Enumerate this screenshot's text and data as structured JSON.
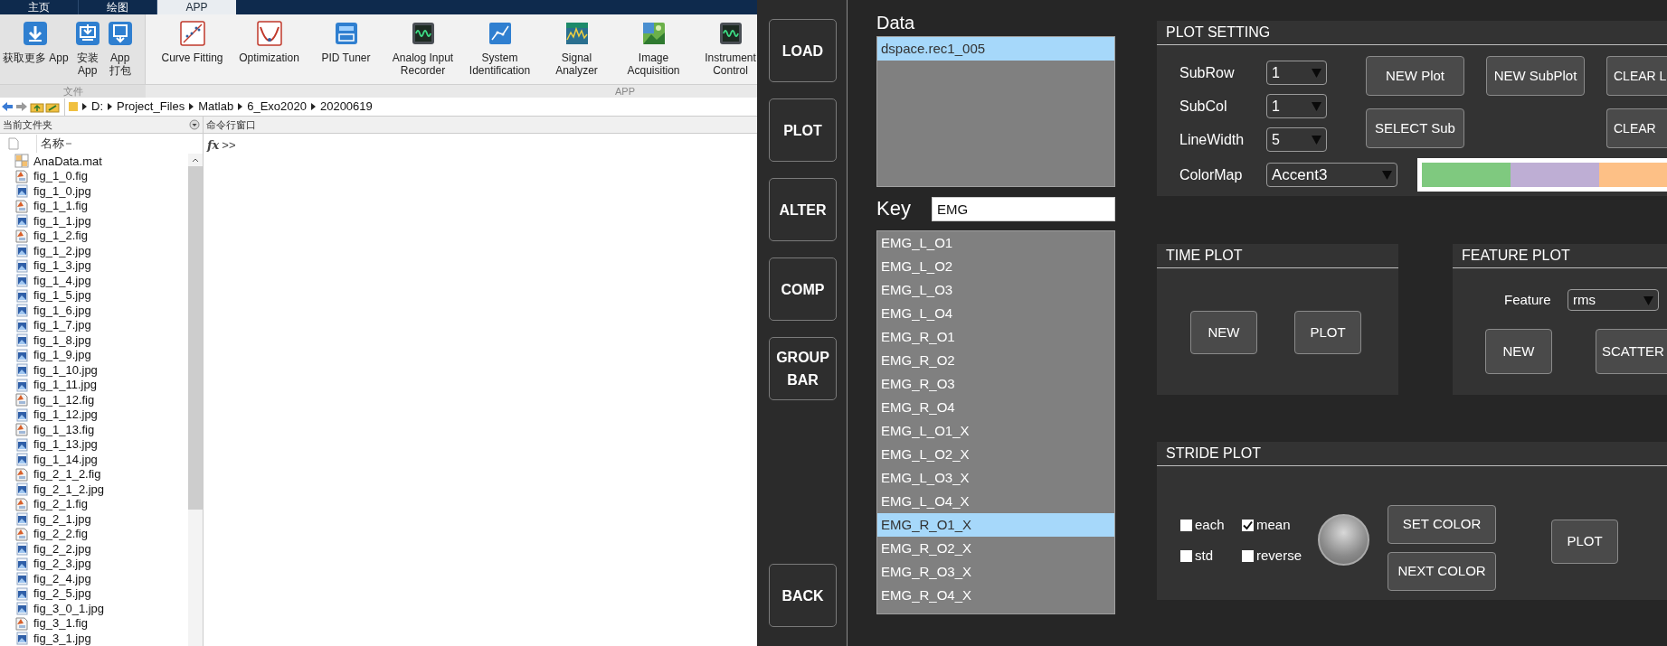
{
  "matlab": {
    "tabs": [
      {
        "label": "主页",
        "selected": false
      },
      {
        "label": "绘图",
        "selected": false
      },
      {
        "label": "APP",
        "selected": true
      }
    ],
    "toolstrip": [
      {
        "label": "文件",
        "tools": [
          {
            "kind": "download",
            "lines": [
              "获取更多 App"
            ]
          },
          {
            "kind": "install",
            "lines": [
              "安装",
              "App"
            ]
          },
          {
            "kind": "package",
            "lines": [
              "App",
              "打包"
            ]
          }
        ]
      },
      {
        "label": "APP",
        "tools": [
          {
            "kind": "curve",
            "lines": [
              "Curve Fitting"
            ]
          },
          {
            "kind": "optimization",
            "lines": [
              "Optimization"
            ]
          },
          {
            "kind": "pid",
            "lines": [
              "PID Tuner"
            ]
          },
          {
            "kind": "recorder",
            "lines": [
              "Analog Input",
              "Recorder"
            ]
          },
          {
            "kind": "identification",
            "lines": [
              "System",
              "Identification"
            ]
          },
          {
            "kind": "signal",
            "lines": [
              "Signal",
              "Analyzer"
            ]
          },
          {
            "kind": "image",
            "lines": [
              "Image",
              "Acquisition"
            ]
          },
          {
            "kind": "instrument",
            "lines": [
              "Instrument",
              "Control"
            ]
          }
        ]
      }
    ],
    "address_path": [
      "D:",
      "Project_Files",
      "Matlab",
      "6_Exo2020",
      "20200619"
    ],
    "current_folder": {
      "title": "当前文件夹",
      "column": "名称",
      "files": [
        {
          "kind": "mat",
          "name": "AnaData.mat"
        },
        {
          "kind": "fig",
          "name": "fig_1_0.fig"
        },
        {
          "kind": "jpg",
          "name": "fig_1_0.jpg"
        },
        {
          "kind": "fig",
          "name": "fig_1_1.fig"
        },
        {
          "kind": "jpg",
          "name": "fig_1_1.jpg"
        },
        {
          "kind": "fig",
          "name": "fig_1_2.fig"
        },
        {
          "kind": "jpg",
          "name": "fig_1_2.jpg"
        },
        {
          "kind": "jpg",
          "name": "fig_1_3.jpg"
        },
        {
          "kind": "jpg",
          "name": "fig_1_4.jpg"
        },
        {
          "kind": "jpg",
          "name": "fig_1_5.jpg"
        },
        {
          "kind": "jpg",
          "name": "fig_1_6.jpg"
        },
        {
          "kind": "jpg",
          "name": "fig_1_7.jpg"
        },
        {
          "kind": "jpg",
          "name": "fig_1_8.jpg"
        },
        {
          "kind": "jpg",
          "name": "fig_1_9.jpg"
        },
        {
          "kind": "jpg",
          "name": "fig_1_10.jpg"
        },
        {
          "kind": "jpg",
          "name": "fig_1_11.jpg"
        },
        {
          "kind": "fig",
          "name": "fig_1_12.fig"
        },
        {
          "kind": "jpg",
          "name": "fig_1_12.jpg"
        },
        {
          "kind": "fig",
          "name": "fig_1_13.fig"
        },
        {
          "kind": "jpg",
          "name": "fig_1_13.jpg"
        },
        {
          "kind": "jpg",
          "name": "fig_1_14.jpg"
        },
        {
          "kind": "fig",
          "name": "fig_2_1_2.fig"
        },
        {
          "kind": "jpg",
          "name": "fig_2_1_2.jpg"
        },
        {
          "kind": "fig",
          "name": "fig_2_1.fig"
        },
        {
          "kind": "jpg",
          "name": "fig_2_1.jpg"
        },
        {
          "kind": "fig",
          "name": "fig_2_2.fig"
        },
        {
          "kind": "jpg",
          "name": "fig_2_2.jpg"
        },
        {
          "kind": "jpg",
          "name": "fig_2_3.jpg"
        },
        {
          "kind": "jpg",
          "name": "fig_2_4.jpg"
        },
        {
          "kind": "jpg",
          "name": "fig_2_5.jpg"
        },
        {
          "kind": "jpg",
          "name": "fig_3_0_1.jpg"
        },
        {
          "kind": "fig",
          "name": "fig_3_1.fig"
        },
        {
          "kind": "jpg",
          "name": "fig_3_1.jpg"
        }
      ]
    },
    "command_window": {
      "title": "命令行窗口",
      "fx": "fx",
      "prompt": ">>"
    }
  },
  "app": {
    "nav": [
      {
        "label": "LOAD"
      },
      {
        "label": "PLOT"
      },
      {
        "label": "ALTER"
      },
      {
        "label": "COMP"
      },
      {
        "label": "GROUP BAR"
      },
      {
        "label": "BACK"
      }
    ],
    "data": {
      "label": "Data",
      "items": [
        {
          "label": "dspace.rec1_005",
          "selected": true
        }
      ]
    },
    "key": {
      "label": "Key",
      "value": "EMG",
      "items": [
        {
          "label": "EMG_L_O1",
          "selected": false
        },
        {
          "label": "EMG_L_O2",
          "selected": false
        },
        {
          "label": "EMG_L_O3",
          "selected": false
        },
        {
          "label": "EMG_L_O4",
          "selected": false
        },
        {
          "label": "EMG_R_O1",
          "selected": false
        },
        {
          "label": "EMG_R_O2",
          "selected": false
        },
        {
          "label": "EMG_R_O3",
          "selected": false
        },
        {
          "label": "EMG_R_O4",
          "selected": false
        },
        {
          "label": "EMG_L_O1_X",
          "selected": false
        },
        {
          "label": "EMG_L_O2_X",
          "selected": false
        },
        {
          "label": "EMG_L_O3_X",
          "selected": false
        },
        {
          "label": "EMG_L_O4_X",
          "selected": false
        },
        {
          "label": "EMG_R_O1_X",
          "selected": true
        },
        {
          "label": "EMG_R_O2_X",
          "selected": false
        },
        {
          "label": "EMG_R_O3_X",
          "selected": false
        },
        {
          "label": "EMG_R_O4_X",
          "selected": false
        }
      ]
    },
    "plot_setting": {
      "title": "PLOT SETTING",
      "fields": [
        {
          "label": "SubRow",
          "value": "1"
        },
        {
          "label": "SubCol",
          "value": "1"
        },
        {
          "label": "LineWidth",
          "value": "5"
        }
      ],
      "button_columns": [
        [
          "NEW Plot",
          "SELECT Sub"
        ],
        [
          "NEW SubPlot"
        ],
        [
          "CLEAR L",
          "CLEAR"
        ]
      ],
      "colormap": {
        "label": "ColorMap",
        "value": "Accent3"
      },
      "colors": [
        {
          "color": "#7fc97f"
        },
        {
          "color": "#beaed4"
        },
        {
          "color": "#fdc086"
        }
      ]
    },
    "time_plot": {
      "title": "TIME PLOT",
      "buttons": [
        "NEW",
        "PLOT"
      ]
    },
    "feature_plot": {
      "title": "FEATURE PLOT",
      "feature": {
        "label": "Feature",
        "value": "rms"
      },
      "buttons": [
        "NEW",
        "SCATTER"
      ]
    },
    "stride_plot": {
      "title": "STRIDE PLOT",
      "checkboxes": [
        {
          "label": "each",
          "checked": false
        },
        {
          "label": "mean",
          "checked": true
        },
        {
          "label": "std",
          "checked": false
        },
        {
          "label": "reverse",
          "checked": false
        }
      ],
      "color_buttons": [
        "SET COLOR",
        "NEXT COLOR"
      ],
      "plot_button": "PLOT"
    }
  }
}
